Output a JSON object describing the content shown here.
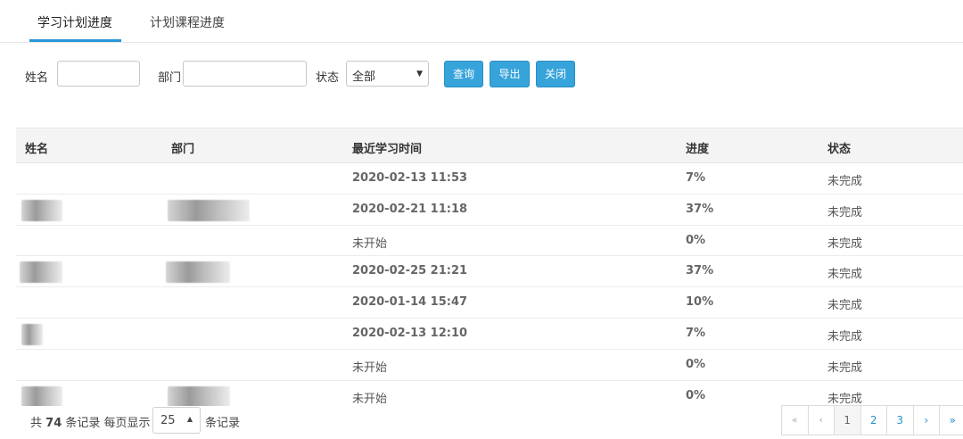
{
  "tabs": [
    {
      "label": "学习计划进度",
      "active": true
    },
    {
      "label": "计划课程进度",
      "active": false
    }
  ],
  "filters": {
    "name_label": "姓名",
    "dept_label": "部门",
    "status_label": "状态",
    "status_value": "全部",
    "query_label": "查询",
    "export_label": "导出",
    "close_label": "关闭"
  },
  "table": {
    "headers": [
      "姓名",
      "部门",
      "最近学习时间",
      "进度",
      "状态"
    ],
    "rows": [
      {
        "time": "2020-02-13 11:53",
        "progress": "7%",
        "status": "未完成"
      },
      {
        "time": "2020-02-21 11:18",
        "progress": "37%",
        "status": "未完成"
      },
      {
        "time": "未开始",
        "progress": "0%",
        "status": "未完成"
      },
      {
        "time": "2020-02-25 21:21",
        "progress": "37%",
        "status": "未完成"
      },
      {
        "time": "2020-01-14 15:47",
        "progress": "10%",
        "status": "未完成"
      },
      {
        "time": "2020-02-13 12:10",
        "progress": "7%",
        "status": "未完成"
      },
      {
        "time": "未开始",
        "progress": "0%",
        "status": "未完成"
      },
      {
        "time": "未开始",
        "progress": "0%",
        "status": "未完成"
      }
    ]
  },
  "footer": {
    "total_prefix": "共",
    "total_count": "74",
    "total_suffix": "条记录 每页显示",
    "page_size": "25",
    "records_suffix": "条记录"
  },
  "pagination": {
    "first": "«",
    "prev": "‹",
    "pages": [
      "1",
      "2",
      "3"
    ],
    "next": "›",
    "last": "»"
  }
}
